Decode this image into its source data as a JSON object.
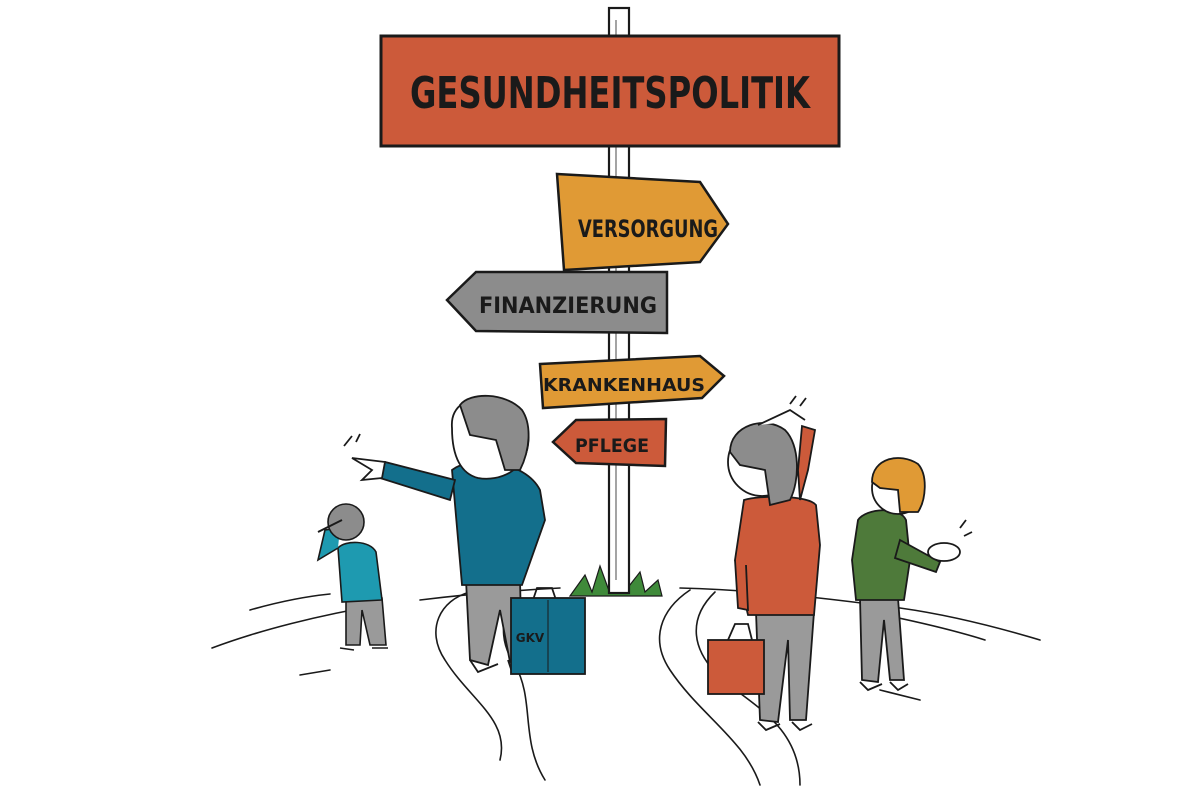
{
  "signs": {
    "main": {
      "label": "GESUNDHEITSPOLITIK",
      "color": "#cc5a3a"
    },
    "arrows": [
      {
        "label": "VERSORGUNG",
        "color": "#e09a35"
      },
      {
        "label": "FINANZIERUNG",
        "color": "#8c8c8c"
      },
      {
        "label": "KRANKENHAUS",
        "color": "#e09a35"
      },
      {
        "label": "PFLEGE",
        "color": "#cc5a3a"
      }
    ]
  },
  "people": {
    "pointing_man": {
      "briefcase_label": "GKV",
      "shirt_color": "#136f8c",
      "bag_color": "#136f8c"
    },
    "child": {
      "shirt_color": "#1e9ab0"
    },
    "woman_red": {
      "jacket_color": "#cc5a3a",
      "bag_color": "#cc5a3a"
    },
    "woman_green": {
      "jacket_color": "#4e7a3a",
      "hair_color": "#e09a35"
    }
  },
  "colors": {
    "outline": "#1a1a1a",
    "hair_grey": "#8c8c8c",
    "pants_grey": "#9a9a9a",
    "grass": "#3f8a3a"
  }
}
